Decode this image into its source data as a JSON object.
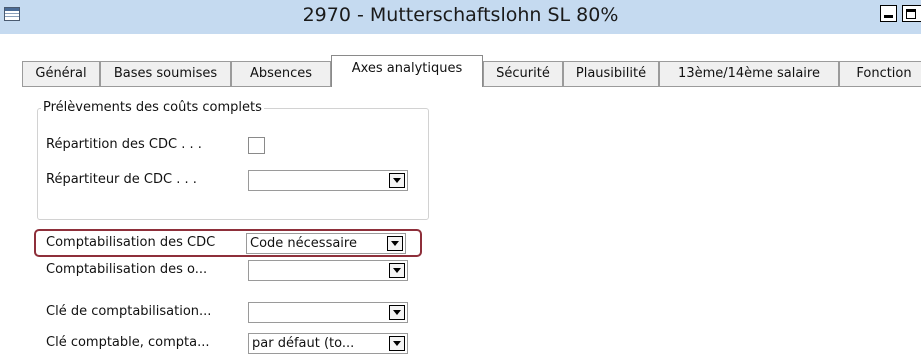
{
  "window": {
    "title": "2970 - Mutterschaftslohn SL 80%"
  },
  "tabs": [
    {
      "label": "Général"
    },
    {
      "label": "Bases soumises"
    },
    {
      "label": "Absences"
    },
    {
      "label": "Axes analytiques",
      "active": true
    },
    {
      "label": "Sécurité"
    },
    {
      "label": "Plausibilité"
    },
    {
      "label": "13ème/14ème salaire"
    },
    {
      "label": "Fonction"
    }
  ],
  "group": {
    "title": "Prélèvements des coûts complets",
    "repartition_label": "Répartition des CDC . . .",
    "repartiteur_label": "Répartiteur de CDC . . .",
    "repartition_checked": false,
    "repartiteur_value": ""
  },
  "fields": [
    {
      "label": "Comptabilisation des CDC",
      "value": "Code nécessaire"
    },
    {
      "label": "Comptabilisation des o...",
      "value": ""
    },
    {
      "label": "Clé de comptabilisation...",
      "value": ""
    },
    {
      "label": "Clé comptable, compta...",
      "value": "par défaut (to..."
    }
  ],
  "colors": {
    "titlebar": "#c5daf0",
    "highlight": "#8e2f3a"
  }
}
